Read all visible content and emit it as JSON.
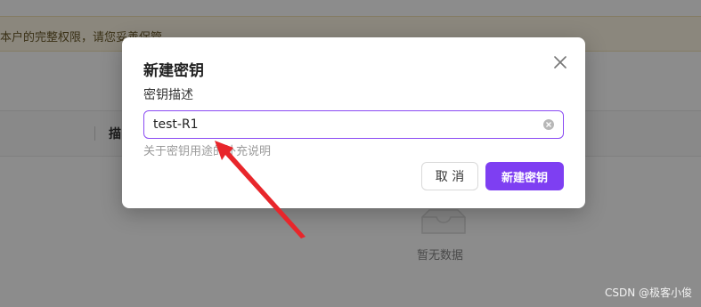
{
  "background": {
    "notice_text": "本户的完整权限，请您妥善保管。",
    "table_column_label": "描",
    "empty_text": "暂无数据"
  },
  "dialog": {
    "title": "新建密钥",
    "field_label": "密钥描述",
    "input_value": "test-R1",
    "hint": "关于密钥用途的补充说明",
    "cancel_label": "取 消",
    "create_label": "新建密钥"
  },
  "watermark": "CSDN @极客小俊",
  "colors": {
    "accent": "#7e3ff2",
    "input_border": "#8a4af3",
    "annotation_arrow": "#e8262b"
  }
}
